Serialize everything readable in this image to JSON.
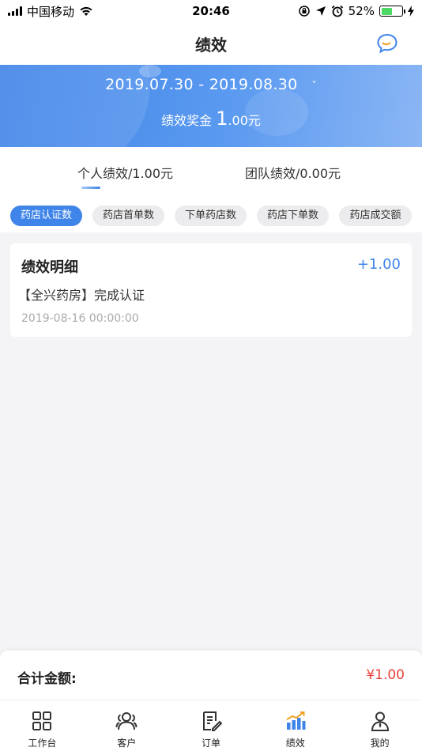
{
  "status_bar": {
    "carrier": "中国移动",
    "time": "20:46",
    "battery_percent": "52%",
    "battery_level": 0.52,
    "icons": [
      "signal-icon",
      "wifi-icon",
      "orientation-lock-icon",
      "location-icon",
      "alarm-icon",
      "battery-icon",
      "charging-icon"
    ]
  },
  "nav": {
    "title": "绩效",
    "message_icon": "chat-bubble-icon"
  },
  "banner": {
    "date_range": "2019.07.30 - 2019.08.30",
    "chevron": "˅",
    "bonus_label": "绩效奖金",
    "bonus_int": "1",
    "bonus_dec": ".00元"
  },
  "perf_tabs": [
    {
      "label": "个人绩效/1.00元",
      "active": true
    },
    {
      "label": "团队绩效/0.00元",
      "active": false
    }
  ],
  "filter_chips": [
    {
      "label": "药店认证数",
      "active": true
    },
    {
      "label": "药店首单数",
      "active": false
    },
    {
      "label": "下单药店数",
      "active": false
    },
    {
      "label": "药店下单数",
      "active": false
    },
    {
      "label": "药店成交额",
      "active": false
    }
  ],
  "detail_card": {
    "title": "绩效明细",
    "amount": "+1.00",
    "description": "【全兴药房】完成认证",
    "time": "2019-08-16 00:00:00"
  },
  "summary": {
    "label": "合计金额:",
    "value": "¥1.00"
  },
  "tabbar": [
    {
      "label": "工作台",
      "icon": "grid-icon",
      "active": false
    },
    {
      "label": "客户",
      "icon": "customers-icon",
      "active": false
    },
    {
      "label": "订单",
      "icon": "order-icon",
      "active": false
    },
    {
      "label": "绩效",
      "icon": "performance-chart-icon",
      "active": true
    },
    {
      "label": "我的",
      "icon": "profile-icon",
      "active": false
    }
  ],
  "colors": {
    "accent": "#3f84e8",
    "amount_red": "#e9423b",
    "battery_green": "#4cd964"
  }
}
